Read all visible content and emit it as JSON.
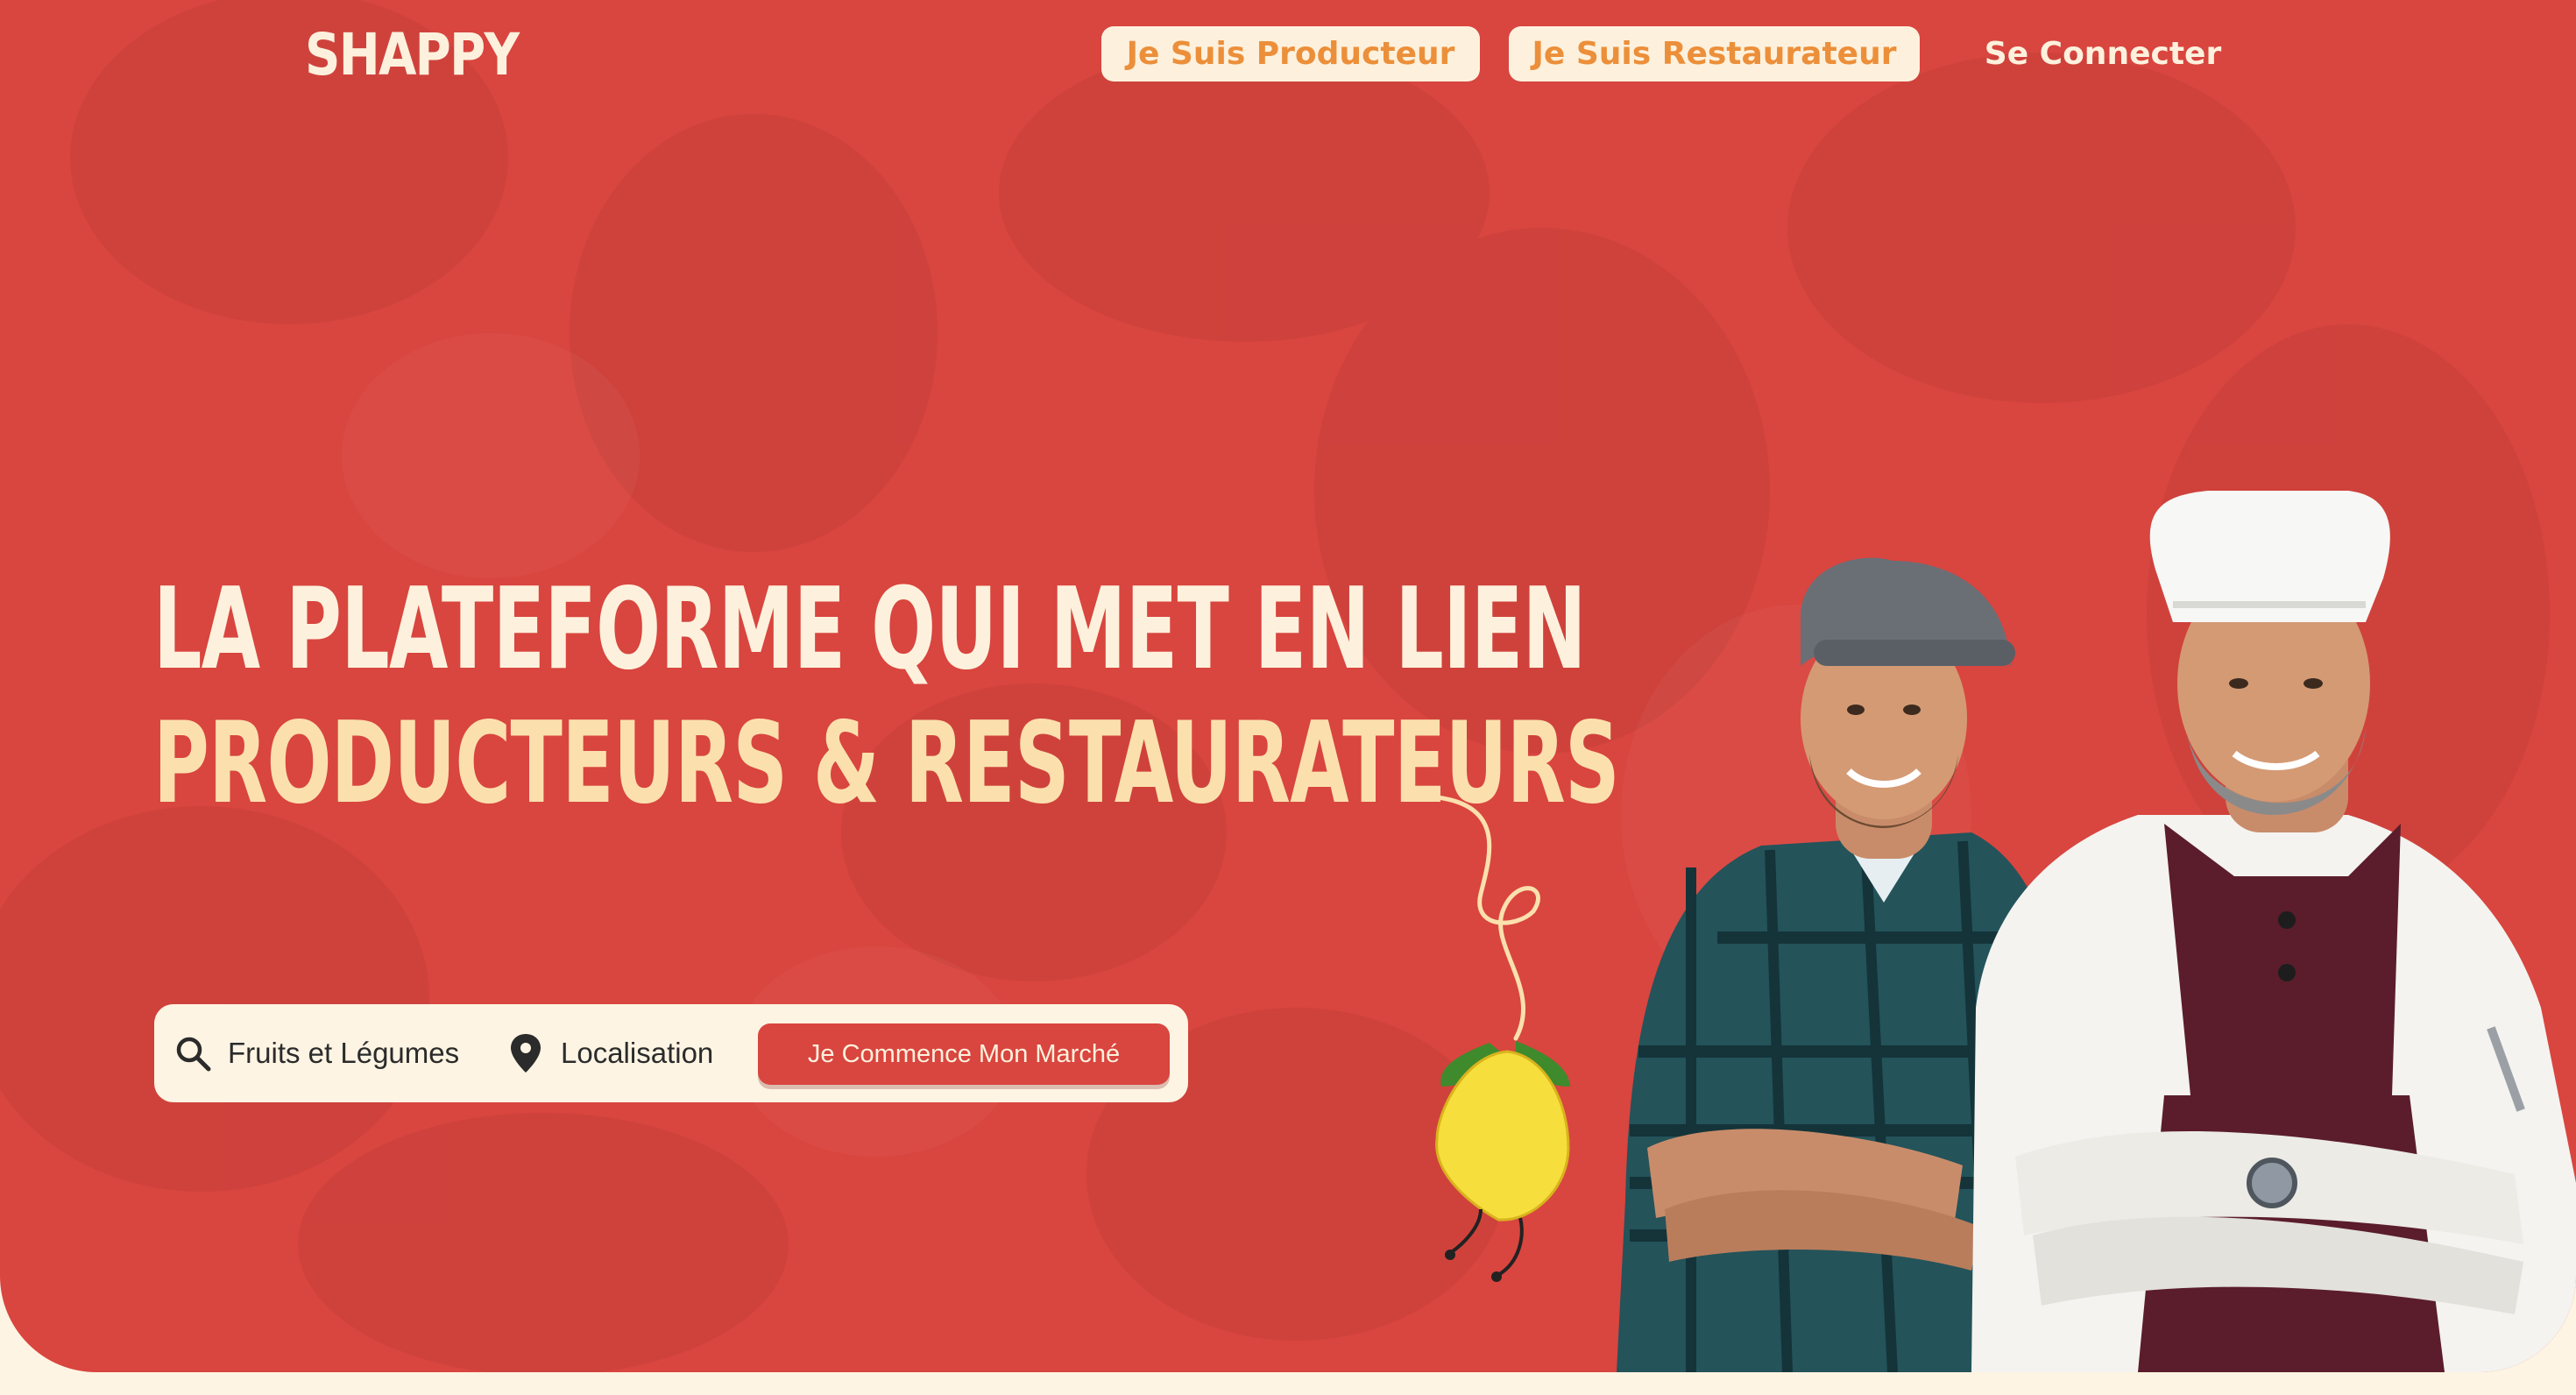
{
  "header": {
    "logo": "SHAPPY",
    "producer_button": "Je Suis Producteur",
    "restaurateur_button": "Je Suis Restaurateur",
    "login_link": "Se Connecter"
  },
  "hero": {
    "headline_line1": "LA PLATEFORME QUI MET EN LIEN",
    "headline_line2": "PRODUCTEURS & RESTAURATEURS"
  },
  "search": {
    "category_value": "Fruits et Légumes",
    "location_value": "Localisation",
    "cta_label": "Je Commence Mon Marché"
  },
  "icons": {
    "search": "search-icon",
    "location": "location-pin-icon",
    "mascot": "lemon-mascot-icon"
  },
  "colors": {
    "hero_background": "#d9453f",
    "cream": "#fdf1dd",
    "accent_orange": "#ec8f3a",
    "headline_yellow": "#fbe0ad",
    "page_background": "#fdf4e3"
  }
}
